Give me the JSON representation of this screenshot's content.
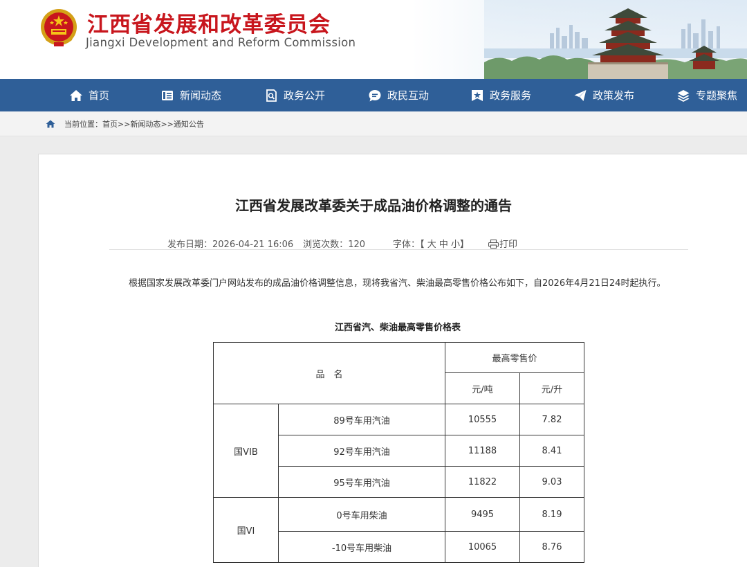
{
  "header": {
    "title": "江西省发展和改革委员会",
    "subtitle": "Jiangxi Development and Reform Commission"
  },
  "nav": {
    "items": [
      {
        "label": "首页",
        "icon": "home-icon"
      },
      {
        "label": "新闻动态",
        "icon": "news-icon"
      },
      {
        "label": "政务公开",
        "icon": "search-doc-icon"
      },
      {
        "label": "政民互动",
        "icon": "chat-icon"
      },
      {
        "label": "政务服务",
        "icon": "star-icon"
      },
      {
        "label": "政策发布",
        "icon": "send-icon"
      },
      {
        "label": "专题聚焦",
        "icon": "layers-icon"
      }
    ]
  },
  "breadcrumb": {
    "prefix": "当前位置：",
    "items": [
      "首页",
      "新闻动态",
      "通知公告"
    ],
    "separator": ">>"
  },
  "article": {
    "title": "江西省发展改革委关于成品油价格调整的通告",
    "meta": {
      "date_label": "发布日期：",
      "date": "2026-04-21 16:06",
      "views_label": "浏览次数：",
      "views": "120",
      "font_label": "字体：",
      "font_open": "【",
      "font_large": "大",
      "font_medium": "中",
      "font_small": "小",
      "font_close": "】",
      "print_label": "打印"
    },
    "paragraph": "根据国家发展改革委门户网站发布的成品油价格调整信息，现将我省汽、柴油最高零售价格公布如下，自2026年4月21日24时起执行。",
    "table_caption": "江西省汽、柴油最高零售价格表"
  },
  "table": {
    "head_name": "品　名",
    "head_price": "最高零售价",
    "unit_ton": "元/吨",
    "unit_liter": "元/升",
    "groups": [
      {
        "standard": "国VIB",
        "rows": [
          {
            "name": "89号车用汽油",
            "per_ton": "10555",
            "per_liter": "7.82"
          },
          {
            "name": "92号车用汽油",
            "per_ton": "11188",
            "per_liter": "8.41"
          },
          {
            "name": "95号车用汽油",
            "per_ton": "11822",
            "per_liter": "9.03"
          }
        ]
      },
      {
        "standard": "国VI",
        "rows": [
          {
            "name": "0号车用柴油",
            "per_ton": "9495",
            "per_liter": "8.19"
          },
          {
            "name": "-10号车用柴油",
            "per_ton": "10065",
            "per_liter": "8.76"
          }
        ]
      }
    ]
  },
  "colors": {
    "brand_red": "#c8161d",
    "nav_blue": "#2f5f98"
  }
}
